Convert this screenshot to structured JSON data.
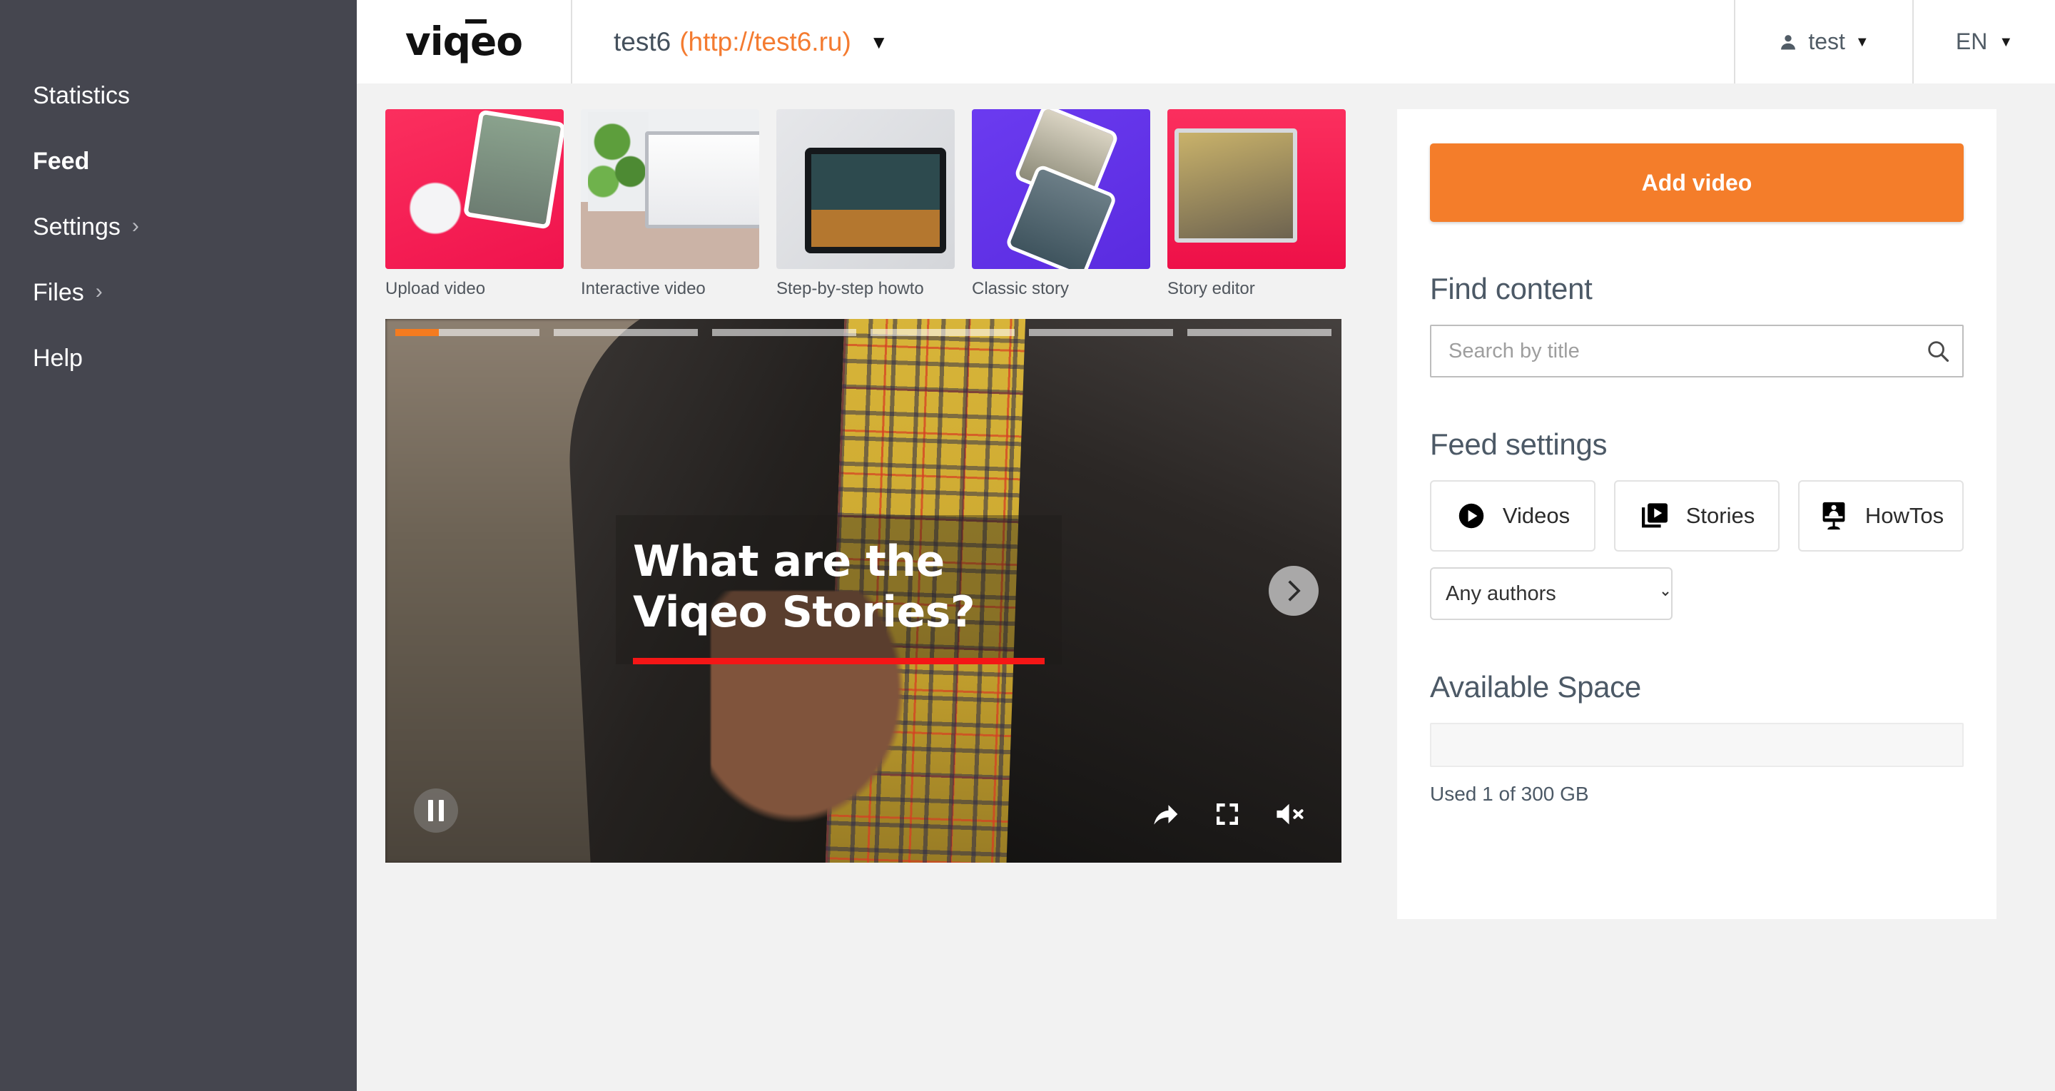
{
  "sidebar": {
    "items": [
      {
        "label": "Statistics",
        "active": false,
        "chevron": false
      },
      {
        "label": "Feed",
        "active": true,
        "chevron": false
      },
      {
        "label": "Settings",
        "active": false,
        "chevron": true
      },
      {
        "label": "Files",
        "active": false,
        "chevron": true
      },
      {
        "label": "Help",
        "active": false,
        "chevron": false
      }
    ],
    "chevron_glyph": "›",
    "background_color": "#45464f"
  },
  "topbar": {
    "logo_text": "viqeo",
    "site_name": "test6",
    "site_url": "(http://test6.ru)",
    "site_caret": "▼",
    "user_name": "test",
    "user_caret": "▼",
    "language": "EN",
    "language_caret": "▼",
    "url_color": "#f47b30"
  },
  "templates": [
    {
      "label": "Upload video"
    },
    {
      "label": "Interactive video"
    },
    {
      "label": "Step-by-step howto"
    },
    {
      "label": "Classic story"
    },
    {
      "label": "Story editor"
    }
  ],
  "player": {
    "title": "What are the Viqeo Stories?",
    "segment_count": 6,
    "current_segment": 1,
    "current_segment_progress_percent": 30,
    "progress_color": "#f47b20",
    "underline_color": "#f41616",
    "is_playing": true,
    "is_muted": true,
    "controls": {
      "pause": "pause",
      "share": "share",
      "fullscreen": "fullscreen",
      "volume": "volume-muted",
      "next": "next"
    }
  },
  "right_panel": {
    "add_video_label": "Add video",
    "add_video_color": "#f47d2a",
    "find_content_title": "Find content",
    "search_placeholder": "Search by title",
    "search_value": "",
    "feed_settings_title": "Feed settings",
    "filters": [
      {
        "label": "Videos",
        "icon": "play-circle-icon"
      },
      {
        "label": "Stories",
        "icon": "stories-icon"
      },
      {
        "label": "HowTos",
        "icon": "howto-monitor-icon"
      }
    ],
    "authors_select": {
      "selected": "Any authors",
      "options": [
        "Any authors"
      ]
    },
    "available_space_title": "Available Space",
    "space_used_text": "Used 1 of 300 GB",
    "space_used_percent": 0
  }
}
